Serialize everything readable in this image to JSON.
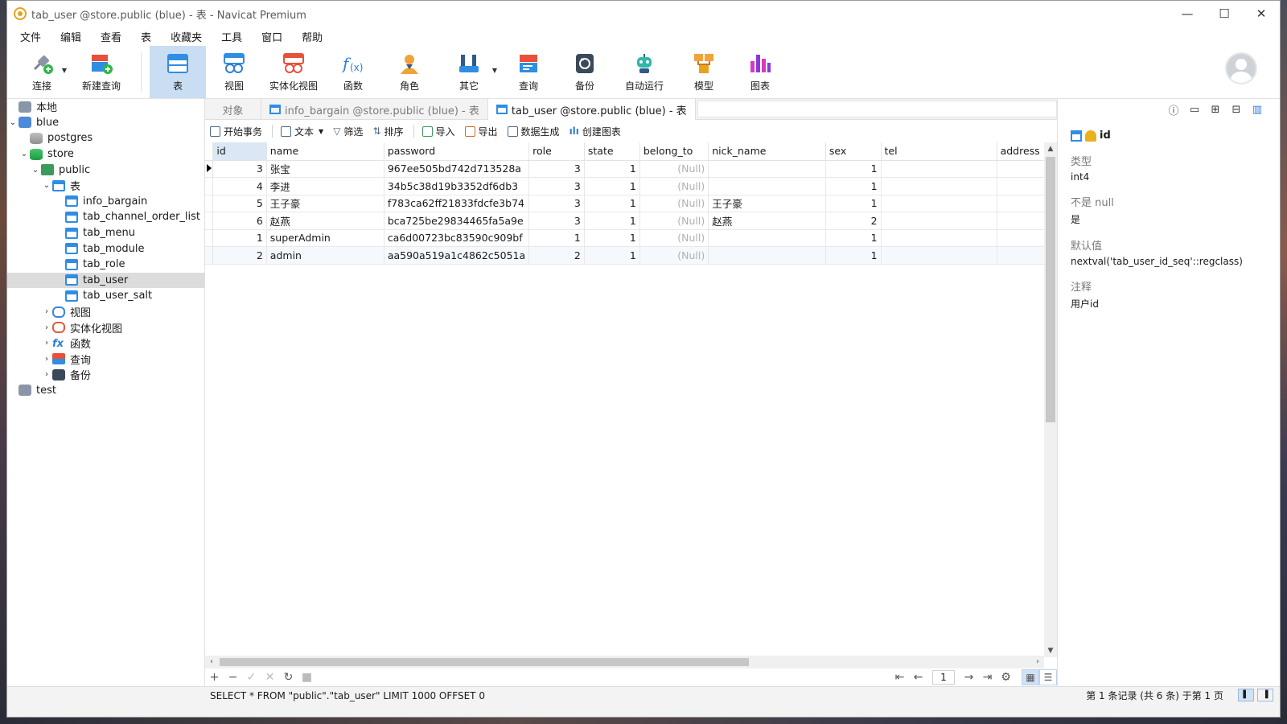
{
  "window": {
    "title": "tab_user @store.public (blue) - 表 - Navicat Premium",
    "controls": [
      "—",
      "☐",
      "✕"
    ]
  },
  "menu": [
    "文件",
    "编辑",
    "查看",
    "表",
    "收藏夹",
    "工具",
    "窗口",
    "帮助"
  ],
  "toolbar": {
    "connect": "连接",
    "new_query": "新建查询",
    "table": "表",
    "view": "视图",
    "mview": "实体化视图",
    "function": "函数",
    "role": "角色",
    "other": "其它",
    "query": "查询",
    "backup": "备份",
    "automation": "自动运行",
    "model": "模型",
    "chart": "图表"
  },
  "navigator": {
    "local": "本地",
    "blue": "blue",
    "postgres": "postgres",
    "store": "store",
    "public": "public",
    "tables_group": "表",
    "tables": [
      "info_bargain",
      "tab_channel_order_list",
      "tab_menu",
      "tab_module",
      "tab_role",
      "tab_user",
      "tab_user_salt"
    ],
    "views": "视图",
    "mviews": "实体化视图",
    "functions": "函数",
    "queries": "查询",
    "backups": "备份",
    "test": "test"
  },
  "tabs": {
    "objects": "对象",
    "tab1": "info_bargain @store.public (blue) - 表",
    "tab2": "tab_user @store.public (blue) - 表"
  },
  "subtoolbar": {
    "begin_tx": "开始事务",
    "text": "文本",
    "filter": "筛选",
    "sort": "排序",
    "import": "导入",
    "export": "导出",
    "data_gen": "数据生成",
    "create_chart": "创建图表"
  },
  "grid": {
    "columns": [
      "id",
      "name",
      "password",
      "role",
      "state",
      "belong_to",
      "nick_name",
      "sex",
      "tel",
      "address"
    ],
    "rows": [
      [
        "3",
        "张宝",
        "967ee505bd742d713528a",
        "3",
        "1",
        "(Null)",
        "",
        "1",
        "",
        ""
      ],
      [
        "4",
        "李进",
        "34b5c38d19b3352df6db3",
        "3",
        "1",
        "(Null)",
        "",
        "1",
        "",
        ""
      ],
      [
        "5",
        "王子豪",
        "f783ca62ff21833fdcfe3b74",
        "3",
        "1",
        "(Null)",
        "王子豪",
        "1",
        "",
        ""
      ],
      [
        "6",
        "赵燕",
        "bca725be29834465fa5a9e",
        "3",
        "1",
        "(Null)",
        "赵燕",
        "2",
        "",
        ""
      ],
      [
        "1",
        "superAdmin",
        "ca6d00723bc83590c909bf",
        "1",
        "1",
        "(Null)",
        "",
        "1",
        "",
        ""
      ],
      [
        "2",
        "admin",
        "aa590a519a1c4862c5051a",
        "2",
        "1",
        "(Null)",
        "",
        "1",
        "",
        ""
      ]
    ]
  },
  "gridbar": {
    "add": "+",
    "remove": "−",
    "apply": "✓",
    "cancel": "✕",
    "refresh": "↻",
    "stop": "■",
    "first": "⇤",
    "prev": "←",
    "page": "1",
    "next": "→",
    "last": "⇥",
    "settings": "⚙"
  },
  "info": {
    "field": "id",
    "type_label": "类型",
    "type_value": "int4",
    "notnull_label": "不是 null",
    "notnull_value": "是",
    "default_label": "默认值",
    "default_value": "nextval('tab_user_id_seq'::regclass)",
    "comment_label": "注释",
    "comment_value": "用户id"
  },
  "status": {
    "sql": "SELECT * FROM \"public\".\"tab_user\" LIMIT 1000 OFFSET 0",
    "records": "第 1 条记录 (共 6 条) 于第 1 页"
  }
}
